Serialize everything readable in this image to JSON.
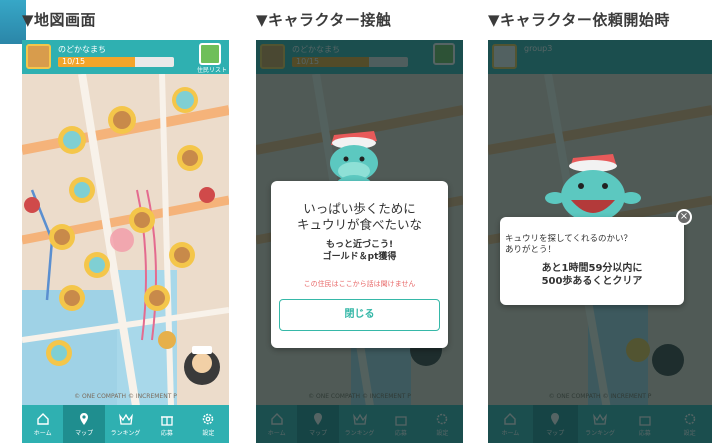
{
  "captions": {
    "map_screen": "▼地図画面",
    "character_contact": "▼キャラクター接触",
    "request_start": "▼キャラクター依頼開始時"
  },
  "hud": {
    "town_name": "のどかなまち",
    "progress_text": "10/15",
    "progress_fraction": 0.667,
    "bag_label": "住民リスト",
    "group_name": "group3"
  },
  "tabs": [
    {
      "label": "ホーム",
      "icon": "home-icon"
    },
    {
      "label": "マップ",
      "icon": "map-pin-icon"
    },
    {
      "label": "ランキング",
      "icon": "crown-icon"
    },
    {
      "label": "応募",
      "icon": "gift-icon"
    },
    {
      "label": "設定",
      "icon": "gear-icon"
    }
  ],
  "copyright": "© ONE COMPATH © INCREMENT P",
  "contact_dialog": {
    "main_line1": "いっぱい歩くために",
    "main_line2": "キュウリが食べたいな",
    "sub_line1": "もっと近づこう!",
    "sub_line2": "ゴールド＆pt獲得",
    "warning": "この住民はここから話は聞けません",
    "close_button": "閉じる"
  },
  "request_dialog": {
    "line1": "キュウリを探してくれるのかい？",
    "line2": "ありがとう！",
    "goal_line1": "あと1時間59分以内に",
    "goal_line2": "500歩あるくとクリア",
    "close_icon": "×"
  },
  "colors": {
    "accent": "#2fb0b1",
    "progress": "#f3a52a",
    "button_border": "#36b8a8",
    "warning": "#e86a6a"
  }
}
